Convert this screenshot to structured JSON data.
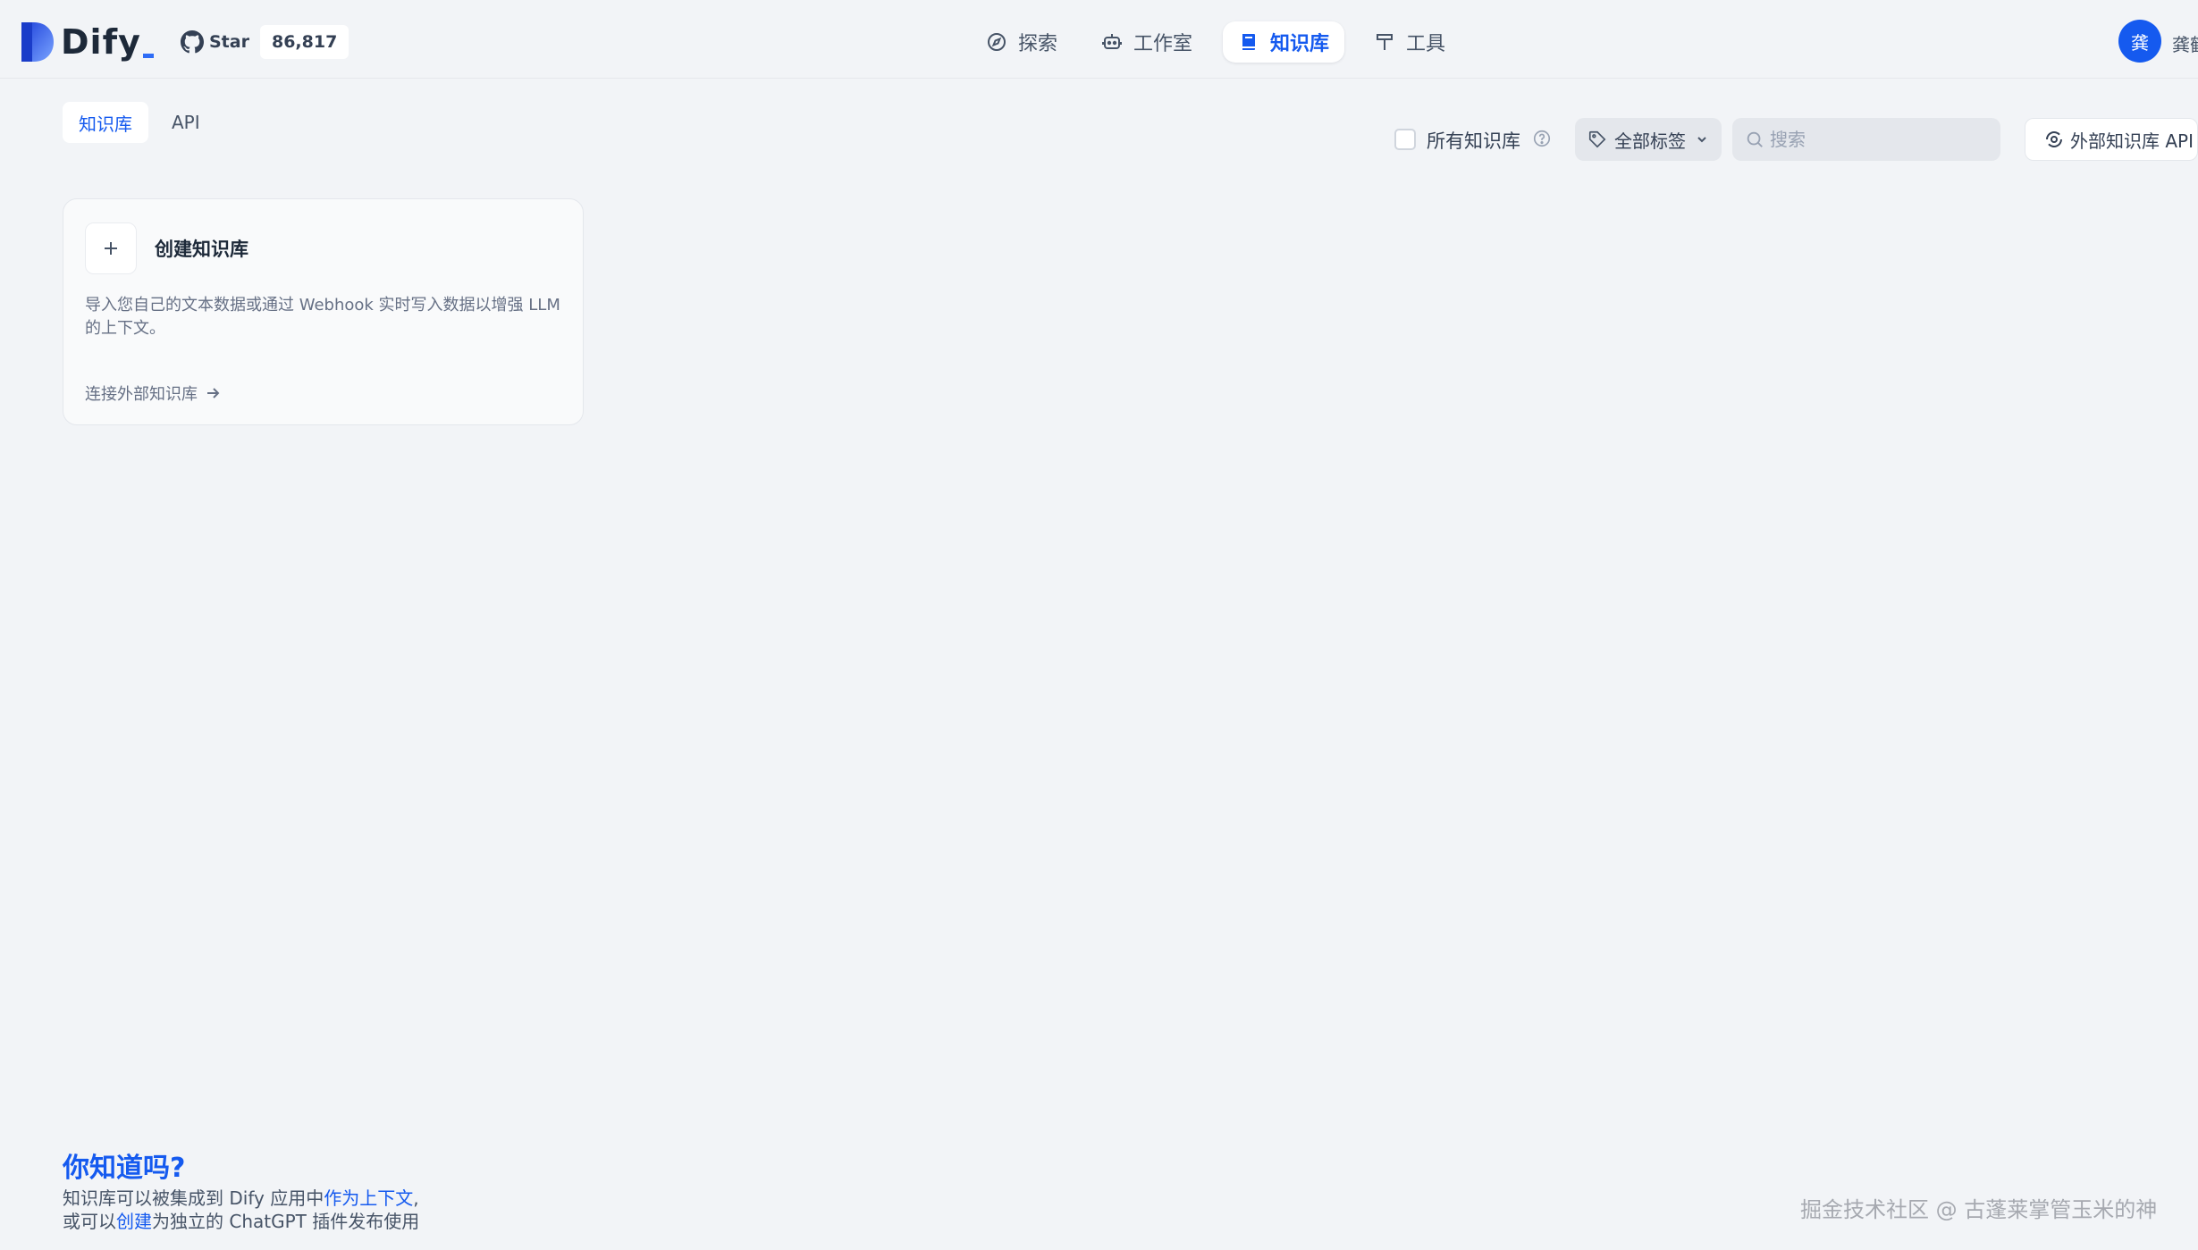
{
  "brand": {
    "name": "Dify",
    "accent": "#155aef"
  },
  "github": {
    "star_label": "Star",
    "count": "86,817"
  },
  "nav": [
    {
      "label": "探索",
      "icon": "compass-icon",
      "active": false
    },
    {
      "label": "工作室",
      "icon": "robot-icon",
      "active": false
    },
    {
      "label": "知识库",
      "icon": "book-icon",
      "active": true
    },
    {
      "label": "工具",
      "icon": "hammer-icon",
      "active": false
    }
  ],
  "user": {
    "avatar_text": "龚",
    "name": "龚鹤"
  },
  "tabs": [
    {
      "label": "知识库",
      "active": true
    },
    {
      "label": "API",
      "active": false
    }
  ],
  "toolbar": {
    "all_datasets_label": "所有知识库",
    "tags_label": "全部标签",
    "search_placeholder": "搜索",
    "external_api_label": "外部知识库 API"
  },
  "create_card": {
    "title": "创建知识库",
    "description": "导入您自己的文本数据或通过 Webhook 实时写入数据以增强 LLM 的上下文。",
    "link_label": "连接外部知识库"
  },
  "tip": {
    "title": "你知道吗?",
    "line1_a": "知识库可以被集成到 Dify 应用中",
    "line1_hl": "作为上下文",
    "line1_b": ",",
    "line2_a": "或可以",
    "line2_hl": "创建",
    "line2_b": "为独立的 ChatGPT 插件发布使用"
  },
  "watermark": "掘金技术社区 @ 古蓬莱掌管玉米的神"
}
